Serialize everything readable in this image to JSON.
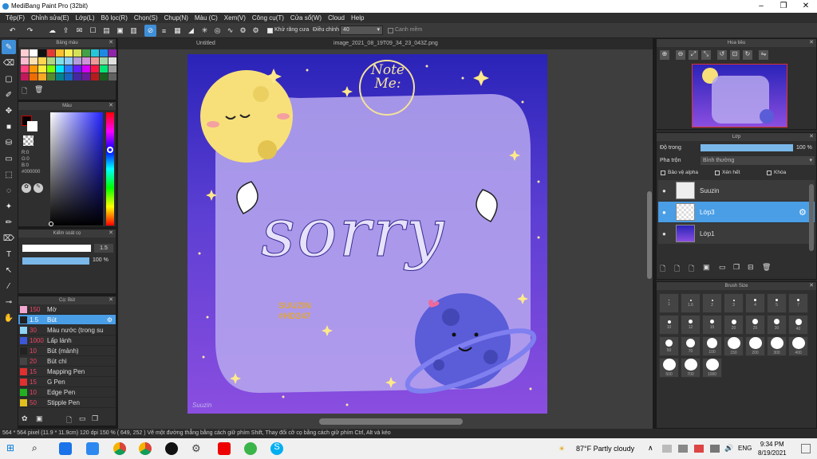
{
  "window": {
    "title": "MediBang Paint Pro (32bit)"
  },
  "menu": [
    "Tệp(F)",
    "Chỉnh sửa(E)",
    "Lớp(L)",
    "Bộ lọc(R)",
    "Chọn(S)",
    "Chụp(N)",
    "Màu (C)",
    "Xem(V)",
    "Công cụ(T)",
    "Cửa sổ(W)",
    "Cloud",
    "Help"
  ],
  "toolbar": {
    "antialias_label": "Khử răng cưa",
    "adjust_label": "Điều chỉnh",
    "adjust_value": "40",
    "smooth_label": "Canh mềm"
  },
  "panels": {
    "swatches": "Bảng màu",
    "color": "Màu",
    "brush_control": "Kiểm soát cọ",
    "brush": "Cọ: Bút",
    "navigator": "Hoa tiêu",
    "layer": "Lớp",
    "brush_size": "Brush Size"
  },
  "color": {
    "r": "R:0",
    "g": "G:0",
    "b": "B:0",
    "hex": "#000000"
  },
  "brush_control": {
    "size": "1.5",
    "opacity": "100 %"
  },
  "brushes": [
    {
      "size": "150",
      "name": "Mờ",
      "color": "#f2a7d0"
    },
    {
      "size": "1.5",
      "name": "Bút",
      "color": "#222",
      "selected": true
    },
    {
      "size": "30",
      "name": "Màu nước (trong su",
      "color": "#8fd3f5"
    },
    {
      "size": "1000",
      "name": "Lấp lánh",
      "color": "#3c58d8"
    },
    {
      "size": "10",
      "name": "Bút (mảnh)",
      "color": "#222"
    },
    {
      "size": "20",
      "name": "Bút chì",
      "color": "#444"
    },
    {
      "size": "15",
      "name": "Mapping Pen",
      "color": "#e03030"
    },
    {
      "size": "15",
      "name": "G Pen",
      "color": "#e03030"
    },
    {
      "size": "10",
      "name": "Edge Pen",
      "color": "#22b022"
    },
    {
      "size": "50",
      "name": "Stipple Pen",
      "color": "#e0c020"
    }
  ],
  "tabs": [
    "Untitled",
    "image_2021_08_19T09_34_23_043Z.png"
  ],
  "artwork": {
    "note_text": "Note Me:",
    "main_text": "sorry",
    "tag_line1": "SUUZIN",
    "tag_line2": "#HD247",
    "sign": "Suuzin"
  },
  "layer_panel": {
    "opacity_label": "Độ trong",
    "opacity_value": "100 %",
    "blend_label": "Pha trộn",
    "blend_value": "Bình thường",
    "protect_alpha": "Bảo vệ alpha",
    "clip": "Xén hết",
    "lock": "Khóa",
    "layers": [
      {
        "name": "Suuzin"
      },
      {
        "name": "Lớp3",
        "selected": true
      },
      {
        "name": "Lớp1"
      }
    ]
  },
  "brush_sizes": [
    "1",
    "1.6",
    "2",
    "3",
    "4",
    "5",
    "7",
    "10",
    "12",
    "15",
    "20",
    "25",
    "30",
    "40",
    "50",
    "70",
    "100",
    "150",
    "200",
    "300",
    "400",
    "500",
    "700",
    "1000"
  ],
  "status": "564 * 564 pixel   (11.9 * 11.9cm)   120 dpi   150 %   ( 649, 252 )   Vẽ một đường thẳng bằng cách giữ phím Shift, Thay đổi cỡ cọ bằng cách giữ phím Ctrl, Alt và kéo",
  "taskbar": {
    "weather": "87°F  Partly cloudy",
    "lang": "ENG",
    "time": "9:34 PM",
    "date": "8/19/2021"
  }
}
